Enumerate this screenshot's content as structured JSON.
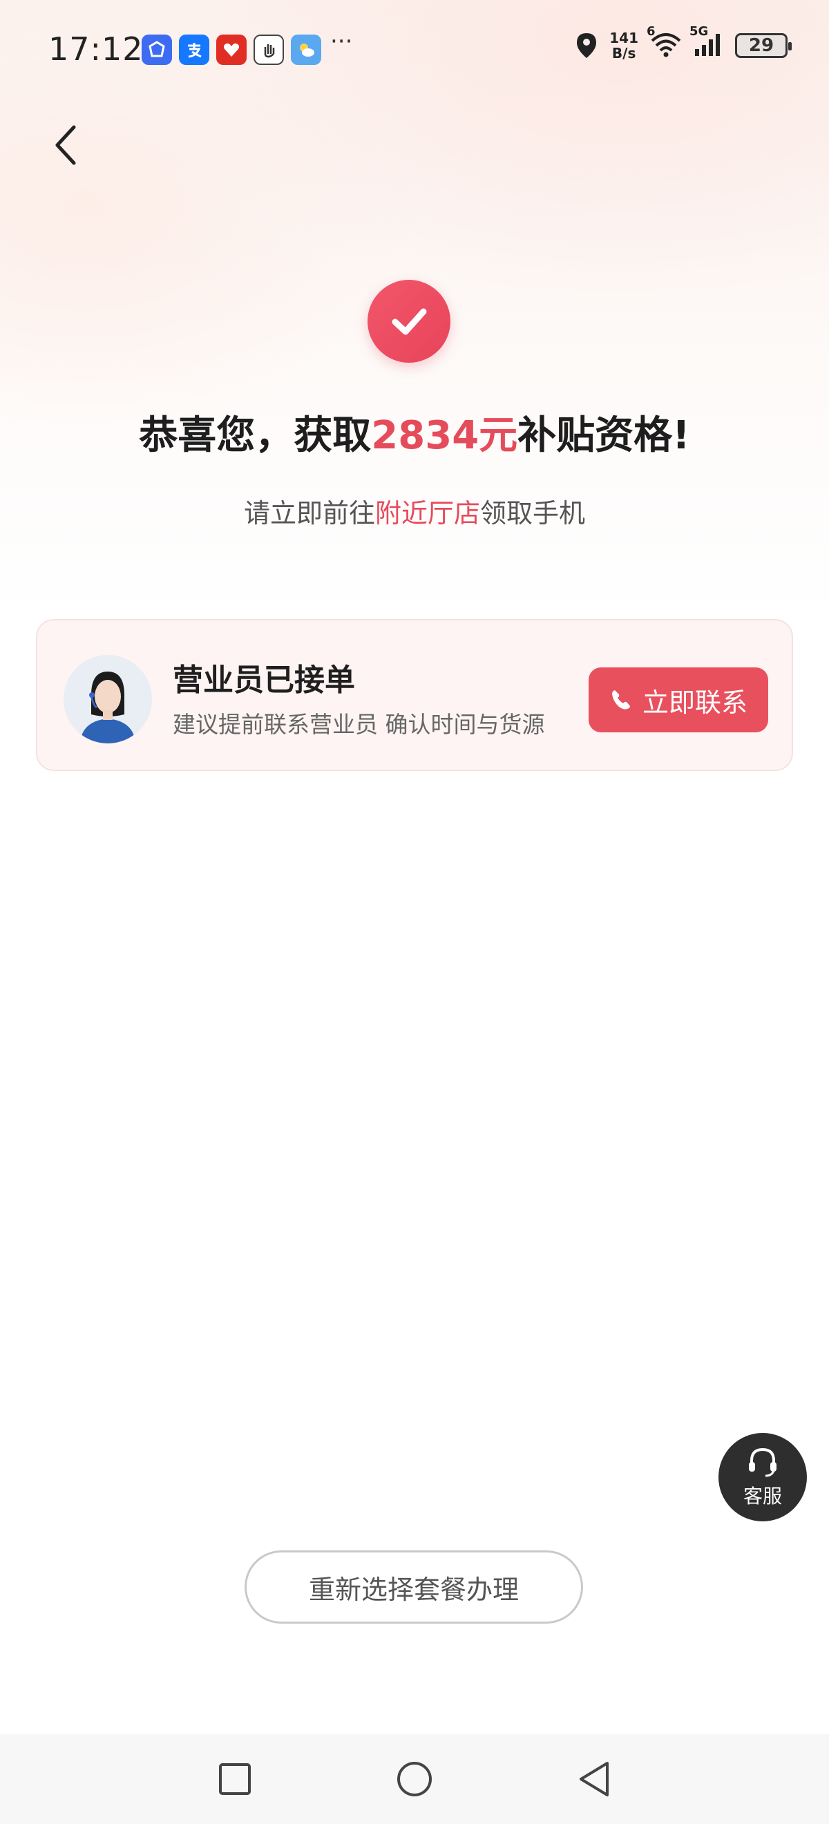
{
  "status_bar": {
    "time": "17:12",
    "dots": "···",
    "net_speed_value": "141",
    "net_speed_unit": "B/s",
    "wifi_label": "6",
    "cell_label": "5G",
    "battery": "29"
  },
  "hero": {
    "headline_prefix": "恭喜您，获取",
    "headline_amount": "2834元",
    "headline_suffix": "补贴资格!",
    "sub_prefix": "请立即前往",
    "sub_highlight": "附近厅店",
    "sub_suffix": "领取手机"
  },
  "card": {
    "title": "营业员已接单",
    "desc": "建议提前联系营业员 确认时间与货源",
    "contact_label": "立即联系"
  },
  "service": {
    "label": "客服"
  },
  "reselect_label": "重新选择套餐办理",
  "colors": {
    "accent": "#e8505e",
    "highlight": "#e54c5b"
  }
}
